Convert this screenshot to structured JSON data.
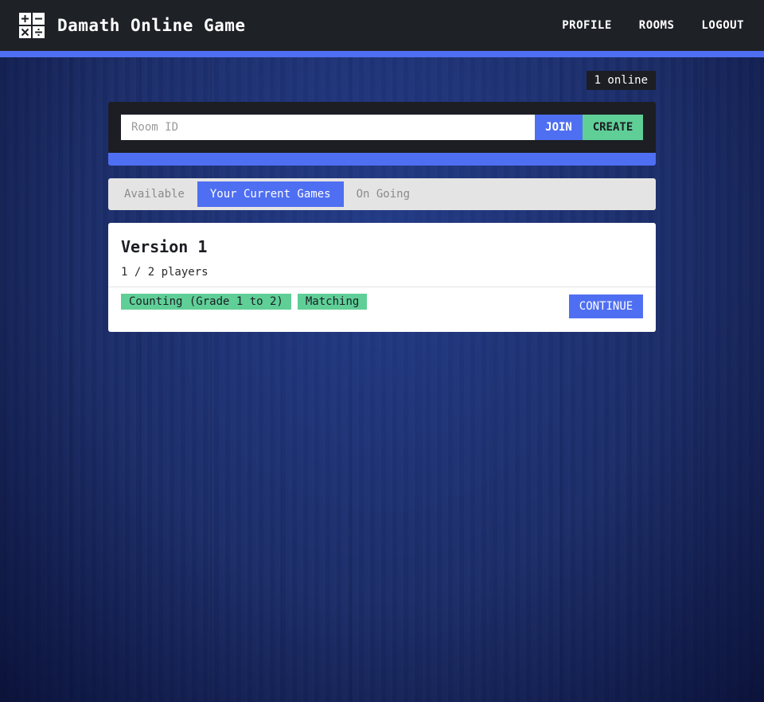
{
  "app": {
    "title": "Damath Online Game",
    "logo_icon": "math-operators-icon"
  },
  "nav": {
    "items": [
      {
        "label": "PROFILE"
      },
      {
        "label": "ROOMS"
      },
      {
        "label": "LOGOUT"
      }
    ]
  },
  "status": {
    "online": "1 online"
  },
  "join": {
    "placeholder": "Room ID",
    "join_label": "JOIN",
    "create_label": "CREATE"
  },
  "tabs": [
    {
      "label": "Available",
      "active": false
    },
    {
      "label": "Your Current Games",
      "active": true
    },
    {
      "label": "On Going",
      "active": false
    }
  ],
  "games": [
    {
      "title": "Version 1",
      "players": "1 / 2 players",
      "tags": [
        "Counting (Grade 1 to 2)",
        "Matching"
      ],
      "action_label": "CONTINUE"
    }
  ],
  "colors": {
    "accent": "#4f6ff2",
    "success": "#5fcf97",
    "navbar": "#1e2126",
    "background": "#1d2f6b"
  }
}
